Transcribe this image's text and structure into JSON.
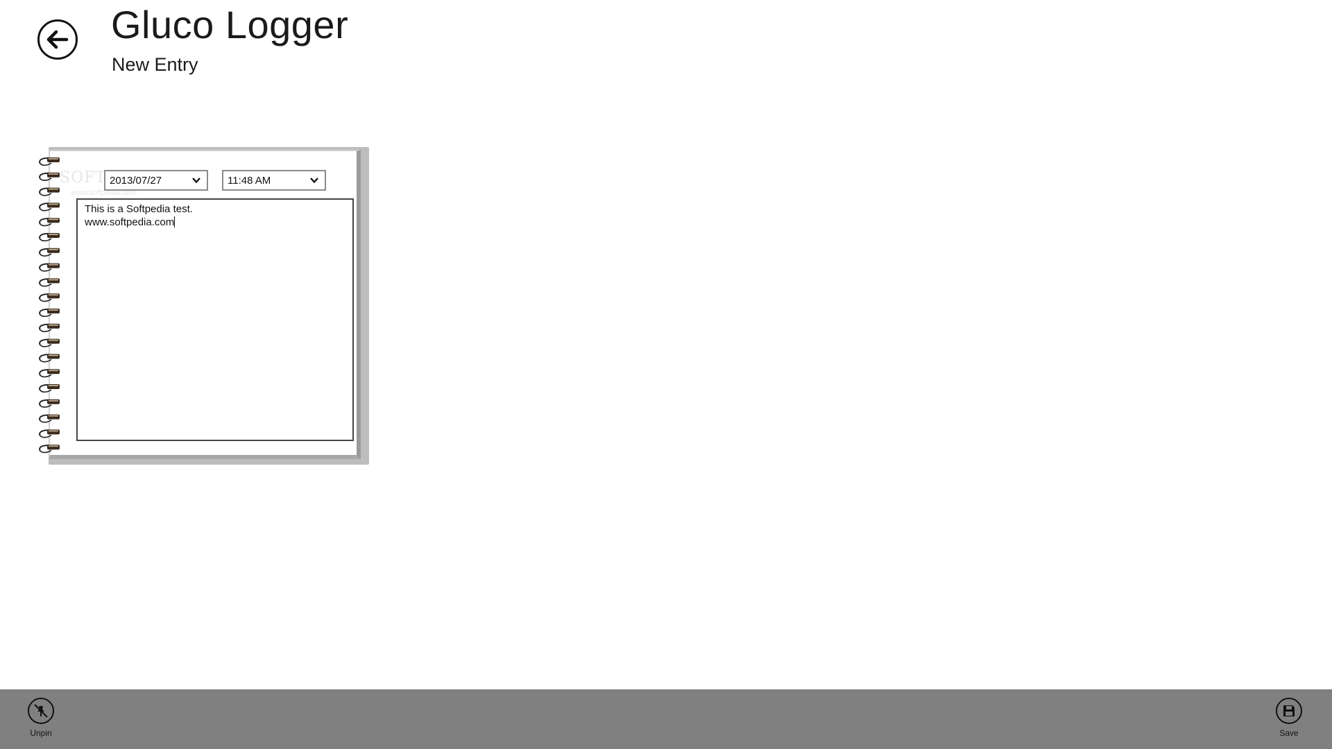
{
  "header": {
    "app_title": "Gluco Logger",
    "subtitle": "New Entry",
    "back_icon": "back-arrow-icon"
  },
  "entry": {
    "date_value": "2013/07/27",
    "time_value": "11:48 AM",
    "notes_lines": [
      "This is a Softpedia test.",
      "",
      "www.softpedia.com"
    ]
  },
  "watermark": {
    "text": "SOFTPEDIA",
    "subtext": "www.softpedia.com"
  },
  "appbar": {
    "unpin_label": "Unpin",
    "unpin_icon": "unpin-icon",
    "save_label": "Save",
    "save_icon": "save-icon",
    "background": "#808080"
  }
}
